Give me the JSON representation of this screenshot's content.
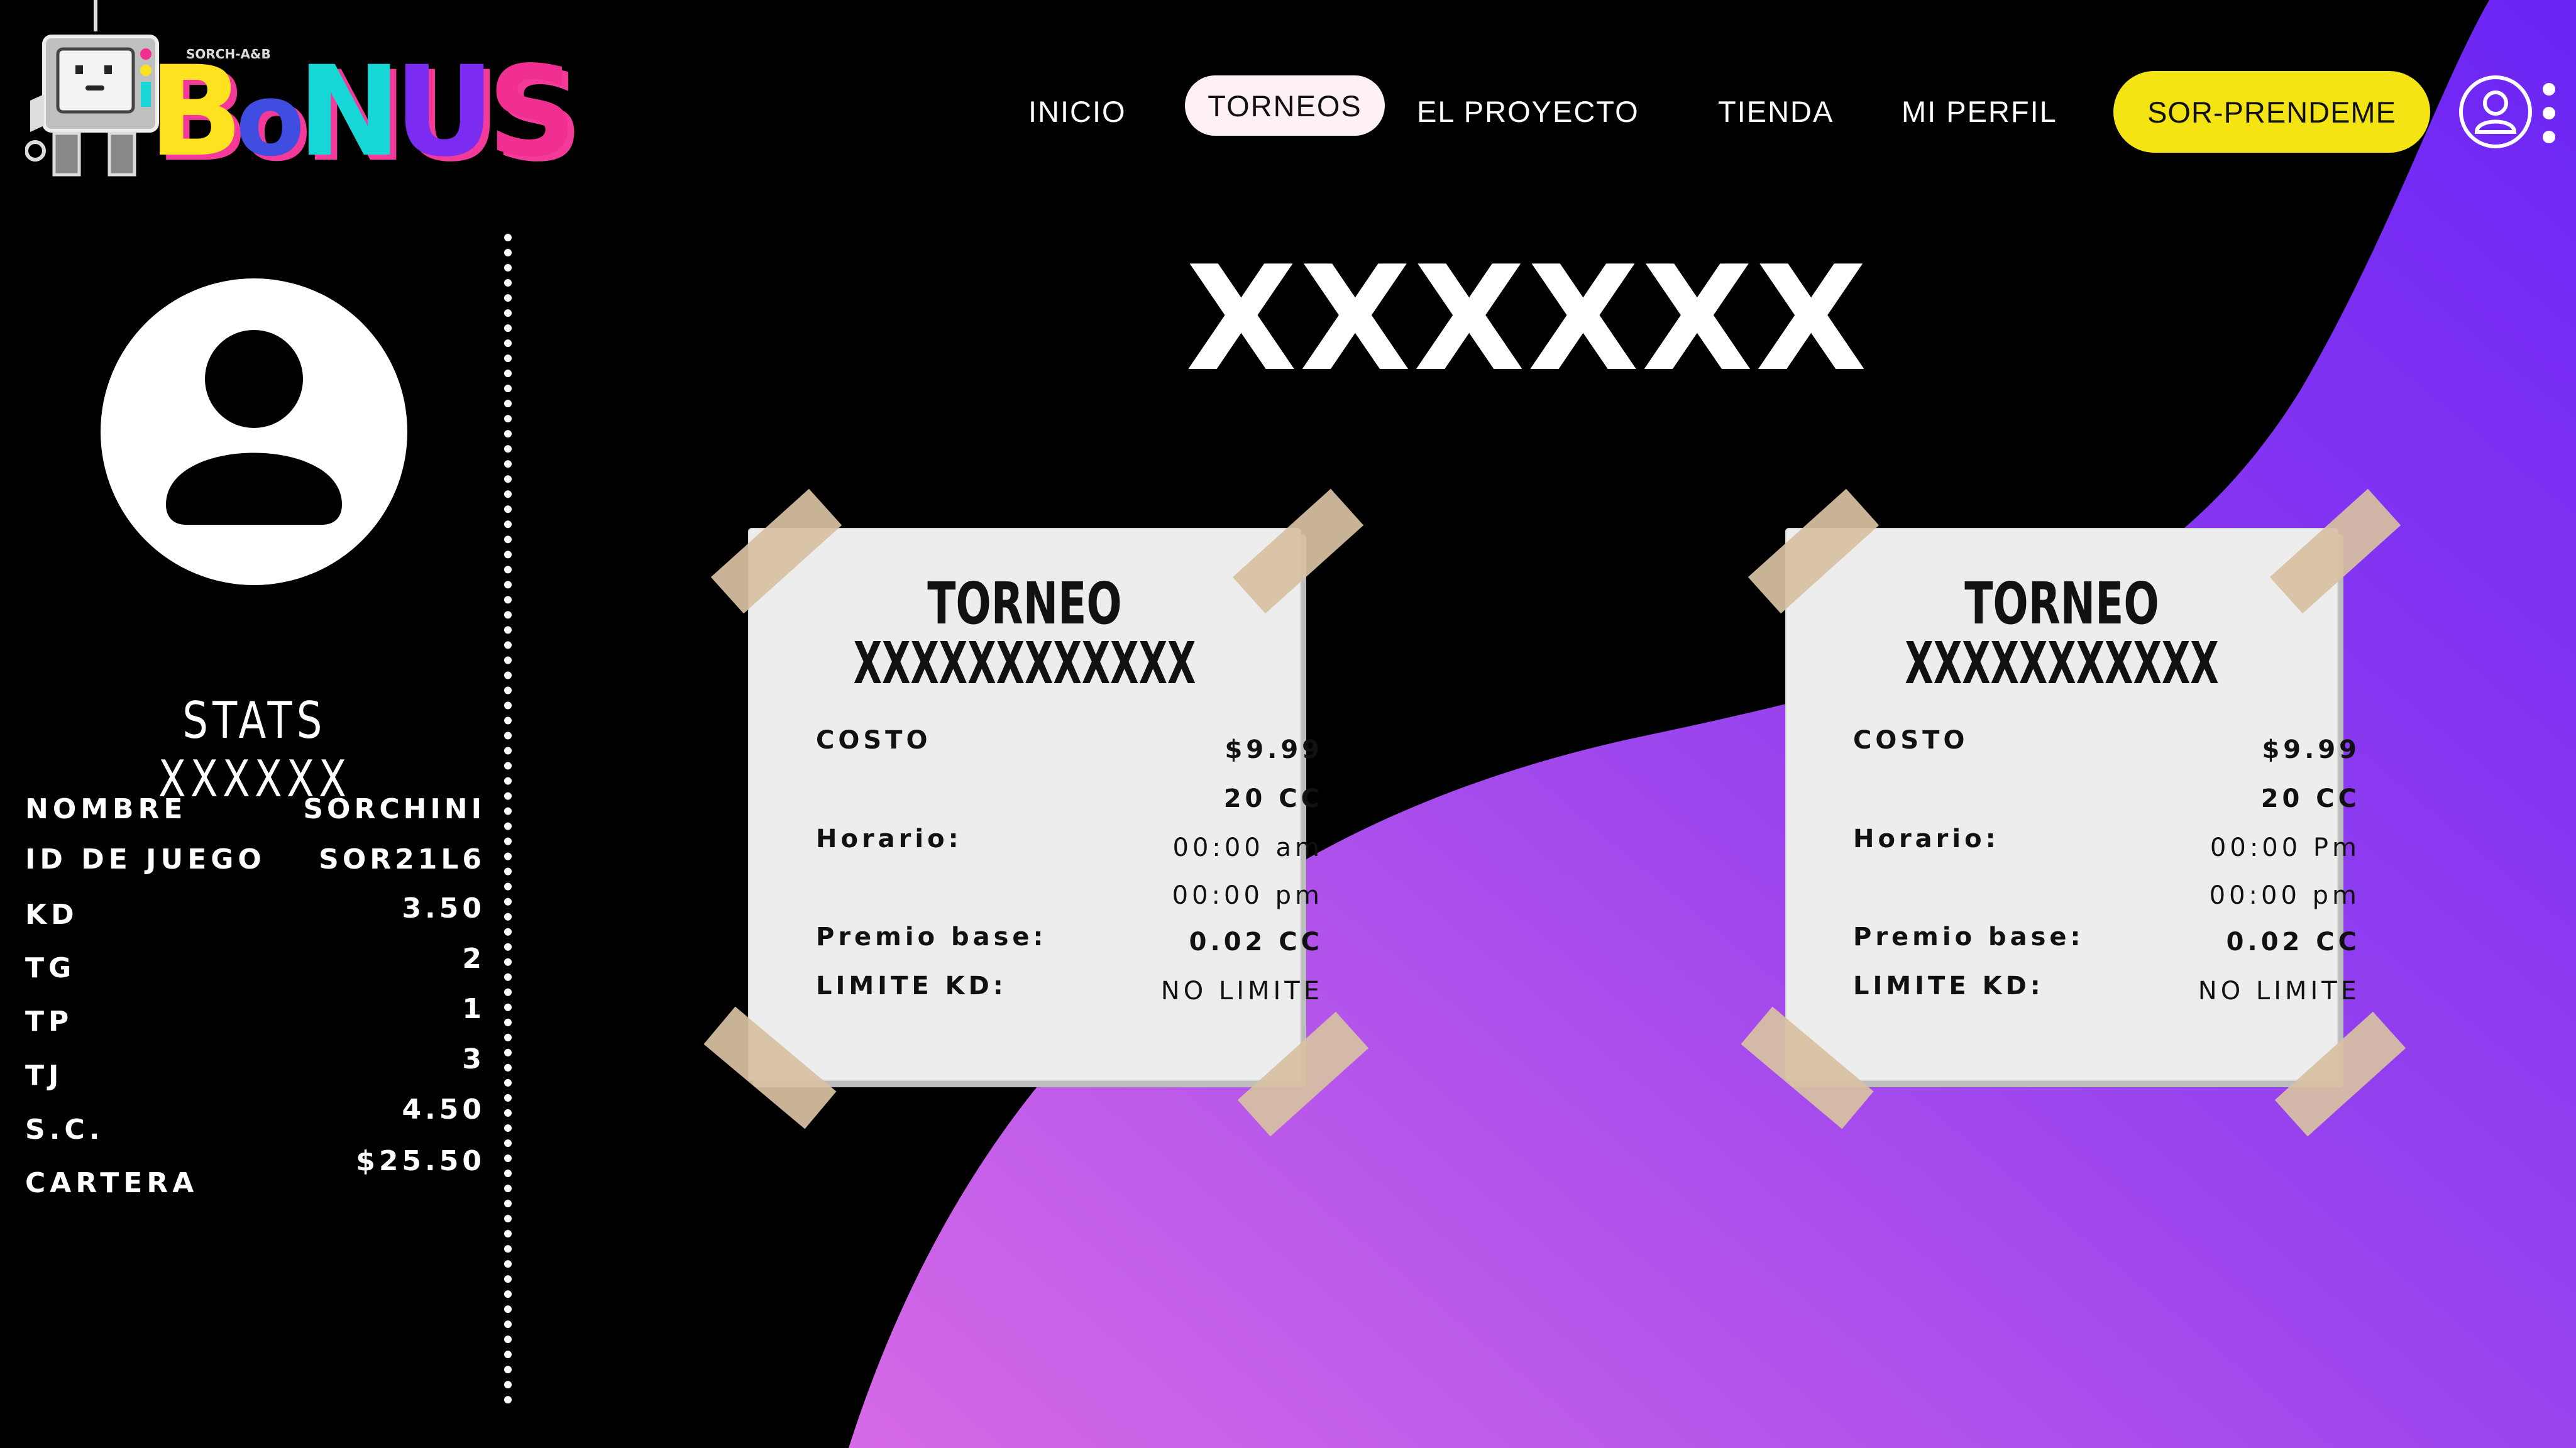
{
  "logo": {
    "tag": "SORCH-A&B",
    "b": "B",
    "o": "o",
    "n": "N",
    "u": "U",
    "s": "S"
  },
  "nav": {
    "inicio": "INICIO",
    "torneos": "TORNEOS",
    "proyecto": "EL PROYECTO",
    "tienda": "TIENDA",
    "perfil": "MI PERFIL",
    "cta": "SOR-PRENDEME"
  },
  "page": {
    "title": "XXXXXX"
  },
  "stats": {
    "title": "STATS XXXXXX",
    "rows": [
      {
        "label": "NOMBRE",
        "value": "SORCHINI"
      },
      {
        "label": "ID DE JUEGO",
        "value": "SOR21L6"
      },
      {
        "label": "KD",
        "value": "3.50"
      },
      {
        "label": "TG",
        "value": "2"
      },
      {
        "label": "TP",
        "value": "1"
      },
      {
        "label": "TJ",
        "value": "3"
      },
      {
        "label": "S.C.",
        "value": "4.50"
      },
      {
        "label": "CARTERA",
        "value": "$25.50"
      }
    ]
  },
  "cards": [
    {
      "heading": "TORNEO",
      "subheading": "XXXXXXXXXXXX",
      "costo_label": "COSTO",
      "costo_usd": "$9.99",
      "costo_cc": "20 CC",
      "horario_label": "Horario:",
      "horario_1": "00:00 am",
      "horario_2": "00:00 pm",
      "premio_label": "Premio base:",
      "premio_value": "0.02 CC",
      "limite_label": "LIMITE KD:",
      "limite_value": "NO LIMITE"
    },
    {
      "heading": "TORNEO",
      "subheading": "XXXXXXXXXXX",
      "costo_label": "COSTO",
      "costo_usd": "$9.99",
      "costo_cc": "20 CC",
      "horario_label": "Horario:",
      "horario_1": "00:00 Pm",
      "horario_2": "00:00 pm",
      "premio_label": "Premio base:",
      "premio_value": "0.02 CC",
      "limite_label": "LIMITE KD:",
      "limite_value": "NO LIMITE"
    }
  ],
  "colors": {
    "background": "#000000",
    "wave_start": "#d66ae6",
    "wave_end": "#6b24f5",
    "cta": "#f5e414",
    "active_tab": "#fdf0f6"
  }
}
